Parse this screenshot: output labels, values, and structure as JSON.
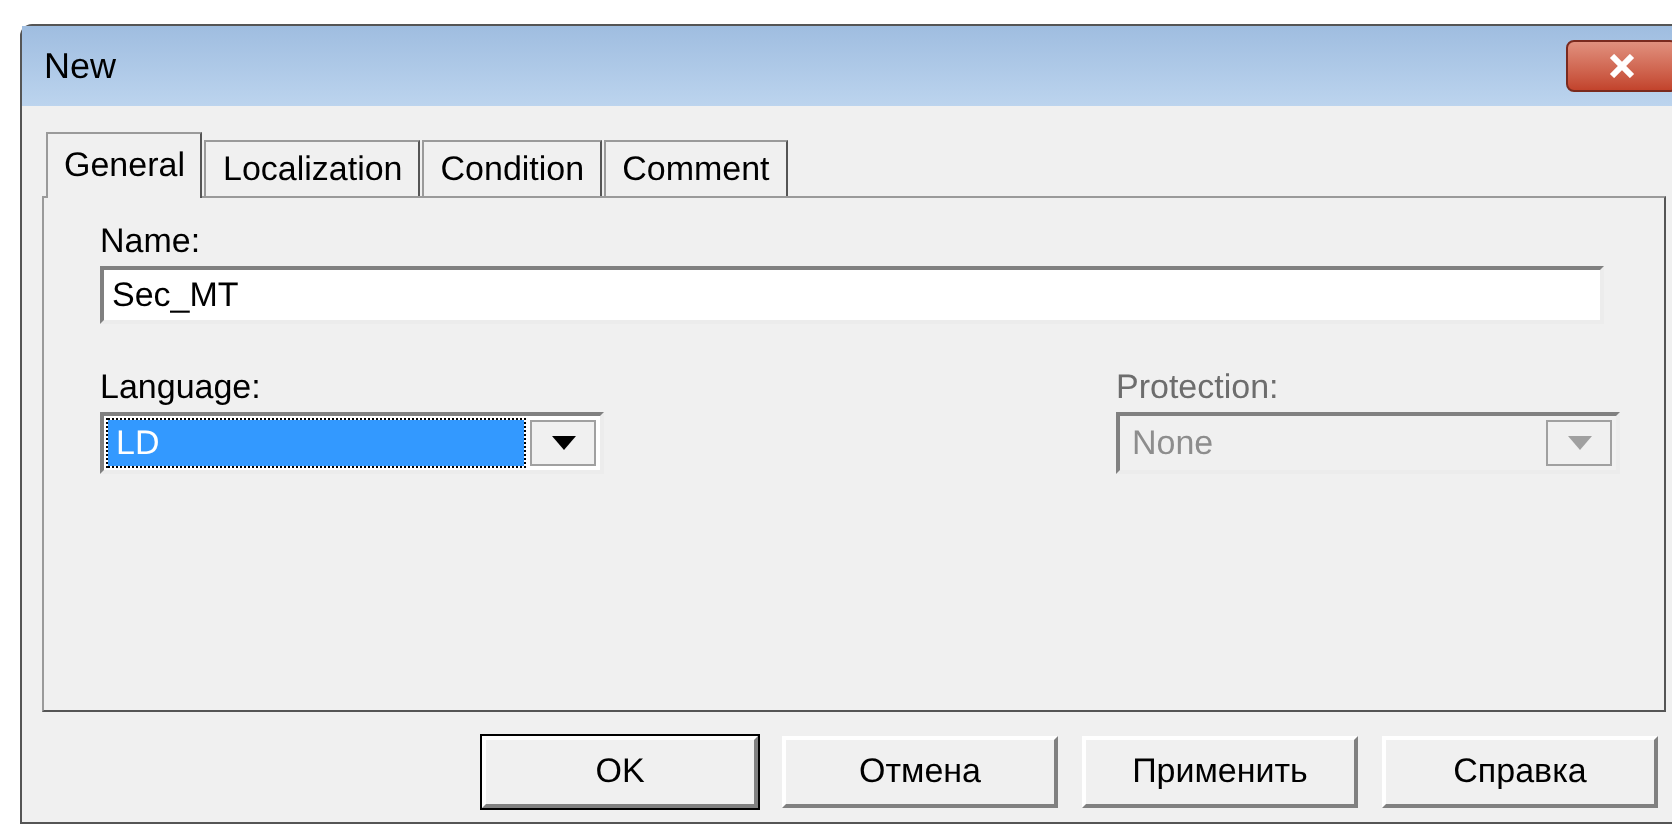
{
  "window": {
    "title": "New"
  },
  "tabs": [
    {
      "label": "General",
      "selected": true
    },
    {
      "label": "Localization",
      "selected": false
    },
    {
      "label": "Condition",
      "selected": false
    },
    {
      "label": "Comment",
      "selected": false
    }
  ],
  "name": {
    "label": "Name:",
    "value": "Sec_MT"
  },
  "language": {
    "label": "Language:",
    "value": "LD",
    "highlighted": true,
    "disabled": false
  },
  "protection": {
    "label": "Protection:",
    "value": "None",
    "highlighted": false,
    "disabled": true
  },
  "buttons": [
    {
      "label": "OK",
      "default": true
    },
    {
      "label": "Отмена",
      "default": false
    },
    {
      "label": "Применить",
      "default": false
    },
    {
      "label": "Справка",
      "default": false
    }
  ]
}
